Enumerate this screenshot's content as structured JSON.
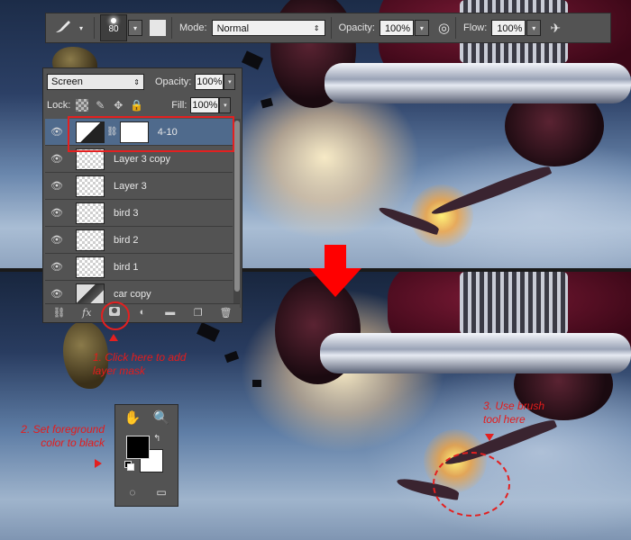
{
  "options_bar": {
    "brush_size": "80",
    "mode_label": "Mode:",
    "mode_value": "Normal",
    "opacity_label": "Opacity:",
    "opacity_value": "100%",
    "flow_label": "Flow:",
    "flow_value": "100%"
  },
  "layers_panel": {
    "blend_mode": "Screen",
    "opacity_label": "Opacity:",
    "opacity_value": "100%",
    "lock_label": "Lock:",
    "fill_label": "Fill:",
    "fill_value": "100%",
    "layers": [
      {
        "name": "4-10",
        "active": true,
        "has_mask": true
      },
      {
        "name": "Layer 3 copy",
        "active": false,
        "has_mask": false
      },
      {
        "name": "Layer 3",
        "active": false,
        "has_mask": false
      },
      {
        "name": "bird 3",
        "active": false,
        "has_mask": false
      },
      {
        "name": "bird 2",
        "active": false,
        "has_mask": false
      },
      {
        "name": "bird 1",
        "active": false,
        "has_mask": false
      },
      {
        "name": "car copy",
        "active": false,
        "has_mask": false
      }
    ]
  },
  "annotations": {
    "step1_line1": "1. Click here to add",
    "step1_line2": "layer mask",
    "step2_line1": "2. Set foreground",
    "step2_line2": "color to black",
    "step3_line1": "3. Use brush",
    "step3_line2": "tool here"
  },
  "colors": {
    "accent_red": "#e32020",
    "panel_gray": "#535353",
    "active_layer_blue": "#4f6a8c",
    "foreground": "#000000",
    "background": "#ffffff"
  },
  "icons": {
    "brush": "brush-icon",
    "eye": "eye-icon",
    "link": "link-icon",
    "fx": "fx-icon",
    "mask": "layer-mask-icon",
    "adjustment": "adjustment-layer-icon",
    "folder": "folder-icon",
    "new_layer": "new-layer-icon",
    "trash": "trash-icon",
    "hand": "hand-icon",
    "zoom": "zoom-icon"
  }
}
